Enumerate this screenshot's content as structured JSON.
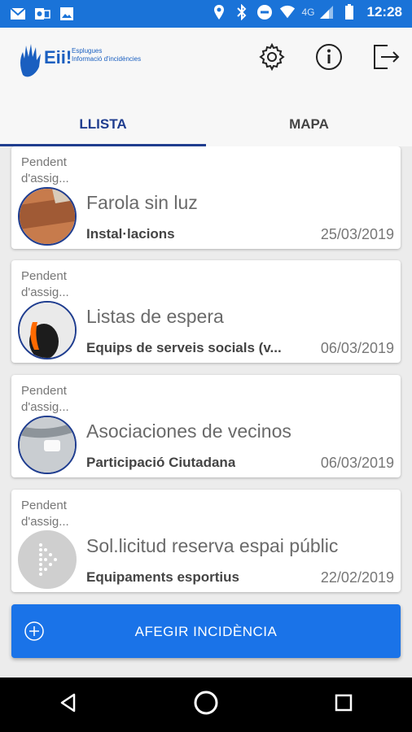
{
  "status_bar": {
    "network": "4G",
    "time": "12:28",
    "left_icons": [
      "gmail-icon",
      "outlook-icon",
      "gallery-icon"
    ],
    "right_icons": [
      "location-icon",
      "bluetooth-icon",
      "dnd-icon",
      "wifi-icon",
      "signal-icon",
      "battery-icon"
    ]
  },
  "header": {
    "logo_name": "Eii!",
    "logo_line1": "Esplugues",
    "logo_line2": "Informació d'incidències",
    "icons": [
      "settings-icon",
      "info-icon",
      "logout-icon"
    ]
  },
  "tabs": [
    {
      "label": "LLISTA",
      "active": true
    },
    {
      "label": "MAPA",
      "active": false
    }
  ],
  "incidents": [
    {
      "status": "Pendent d'assig...",
      "title": "Farola sin luz",
      "category": "Instal·lacions",
      "date": "25/03/2019"
    },
    {
      "status": "Pendent d'assig...",
      "title": "Listas de espera",
      "category": "Equips de serveis socials (v...",
      "date": "06/03/2019"
    },
    {
      "status": "Pendent d'assig...",
      "title": "Asociaciones de vecinos",
      "category": "Participació Ciutadana",
      "date": "06/03/2019"
    },
    {
      "status": "Pendent d'assig...",
      "title": "Sol.licitud reserva espai públic",
      "category": "Equipaments esportius",
      "date": "22/02/2019"
    }
  ],
  "add_button": {
    "label": "AFEGIR INCIDÈNCIA"
  },
  "nav": [
    "back-icon",
    "home-icon",
    "recents-icon"
  ],
  "colors": {
    "status_bar": "#1a73d8",
    "accent": "#1f3d8f",
    "button": "#1a73e8"
  }
}
